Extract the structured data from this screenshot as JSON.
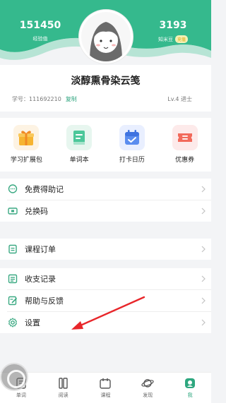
{
  "header": {
    "left_stat": {
      "value": "151450",
      "label": "经验值"
    },
    "right_stat": {
      "value": "3193",
      "label": "知米豆",
      "badge": "充值"
    },
    "bg_color": "#2fb98c"
  },
  "profile": {
    "username": "淡醇熏骨染云笺",
    "id_label": "学号：111692210",
    "copy_label": "复制",
    "level": "Lv.4 进士"
  },
  "quick": [
    {
      "label": "学习扩展包",
      "icon": "gift-box-icon"
    },
    {
      "label": "单词本",
      "icon": "word-book-icon"
    },
    {
      "label": "打卡日历",
      "icon": "calendar-icon"
    },
    {
      "label": "优惠券",
      "icon": "coupon-icon"
    }
  ],
  "menu_group1": [
    {
      "label": "免费得助记",
      "icon": "chat-bubble-icon"
    },
    {
      "label": "兑换码",
      "icon": "ticket-icon"
    }
  ],
  "menu_group2": [
    {
      "label": "课程订单",
      "icon": "order-list-icon"
    }
  ],
  "menu_group3": [
    {
      "label": "收支记录",
      "icon": "record-icon"
    },
    {
      "label": "帮助与反馈",
      "icon": "edit-note-icon"
    },
    {
      "label": "设置",
      "icon": "gear-icon"
    }
  ],
  "bottom_nav": [
    {
      "label": "单词",
      "icon": "word-icon"
    },
    {
      "label": "阅读",
      "icon": "read-icon"
    },
    {
      "label": "课程",
      "icon": "course-icon"
    },
    {
      "label": "发现",
      "icon": "planet-icon"
    },
    {
      "label": "我",
      "icon": "me-icon",
      "active": true
    }
  ],
  "accent": "#2ea77f",
  "annotation_color": "#e8262a"
}
